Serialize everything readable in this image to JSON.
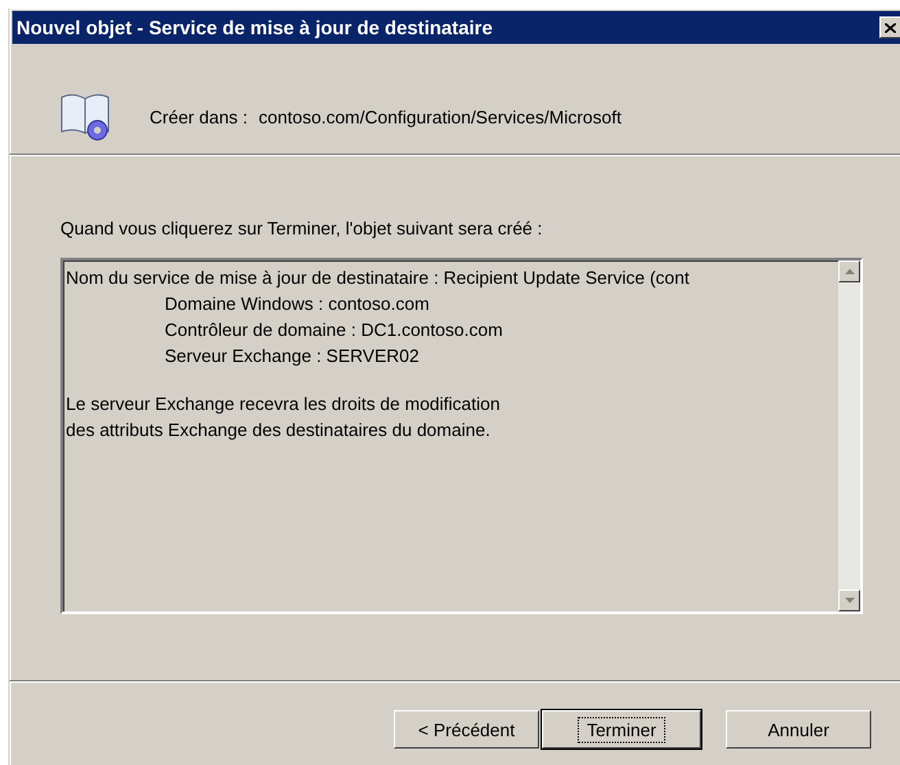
{
  "window": {
    "title": "Nouvel objet - Service de mise à jour de destinataire"
  },
  "header": {
    "label": "Créer dans :",
    "path": "contoso.com/Configuration/Services/Microsoft"
  },
  "intro": "Quand vous cliquerez sur Terminer, l'objet suivant sera créé :",
  "summary": {
    "paragraphs": [
      {
        "lines": [
          {
            "text": "Nom du service de mise à jour de destinataire : Recipient Update Service (cont",
            "indented": false
          },
          {
            "text": "Domaine Windows : contoso.com",
            "indented": true
          },
          {
            "text": "Contrôleur de domaine : DC1.contoso.com",
            "indented": true
          },
          {
            "text": "Serveur Exchange : SERVER02",
            "indented": true
          }
        ]
      },
      {
        "lines": [
          {
            "text": "Le serveur Exchange recevra les droits de modification",
            "indented": false
          },
          {
            "text": "des attributs Exchange des destinataires du domaine.",
            "indented": false
          }
        ]
      }
    ]
  },
  "buttons": [
    {
      "label": "< Précédent",
      "default": false
    },
    {
      "label": "Terminer",
      "default": true
    },
    {
      "label": "Annuler",
      "default": false
    }
  ]
}
